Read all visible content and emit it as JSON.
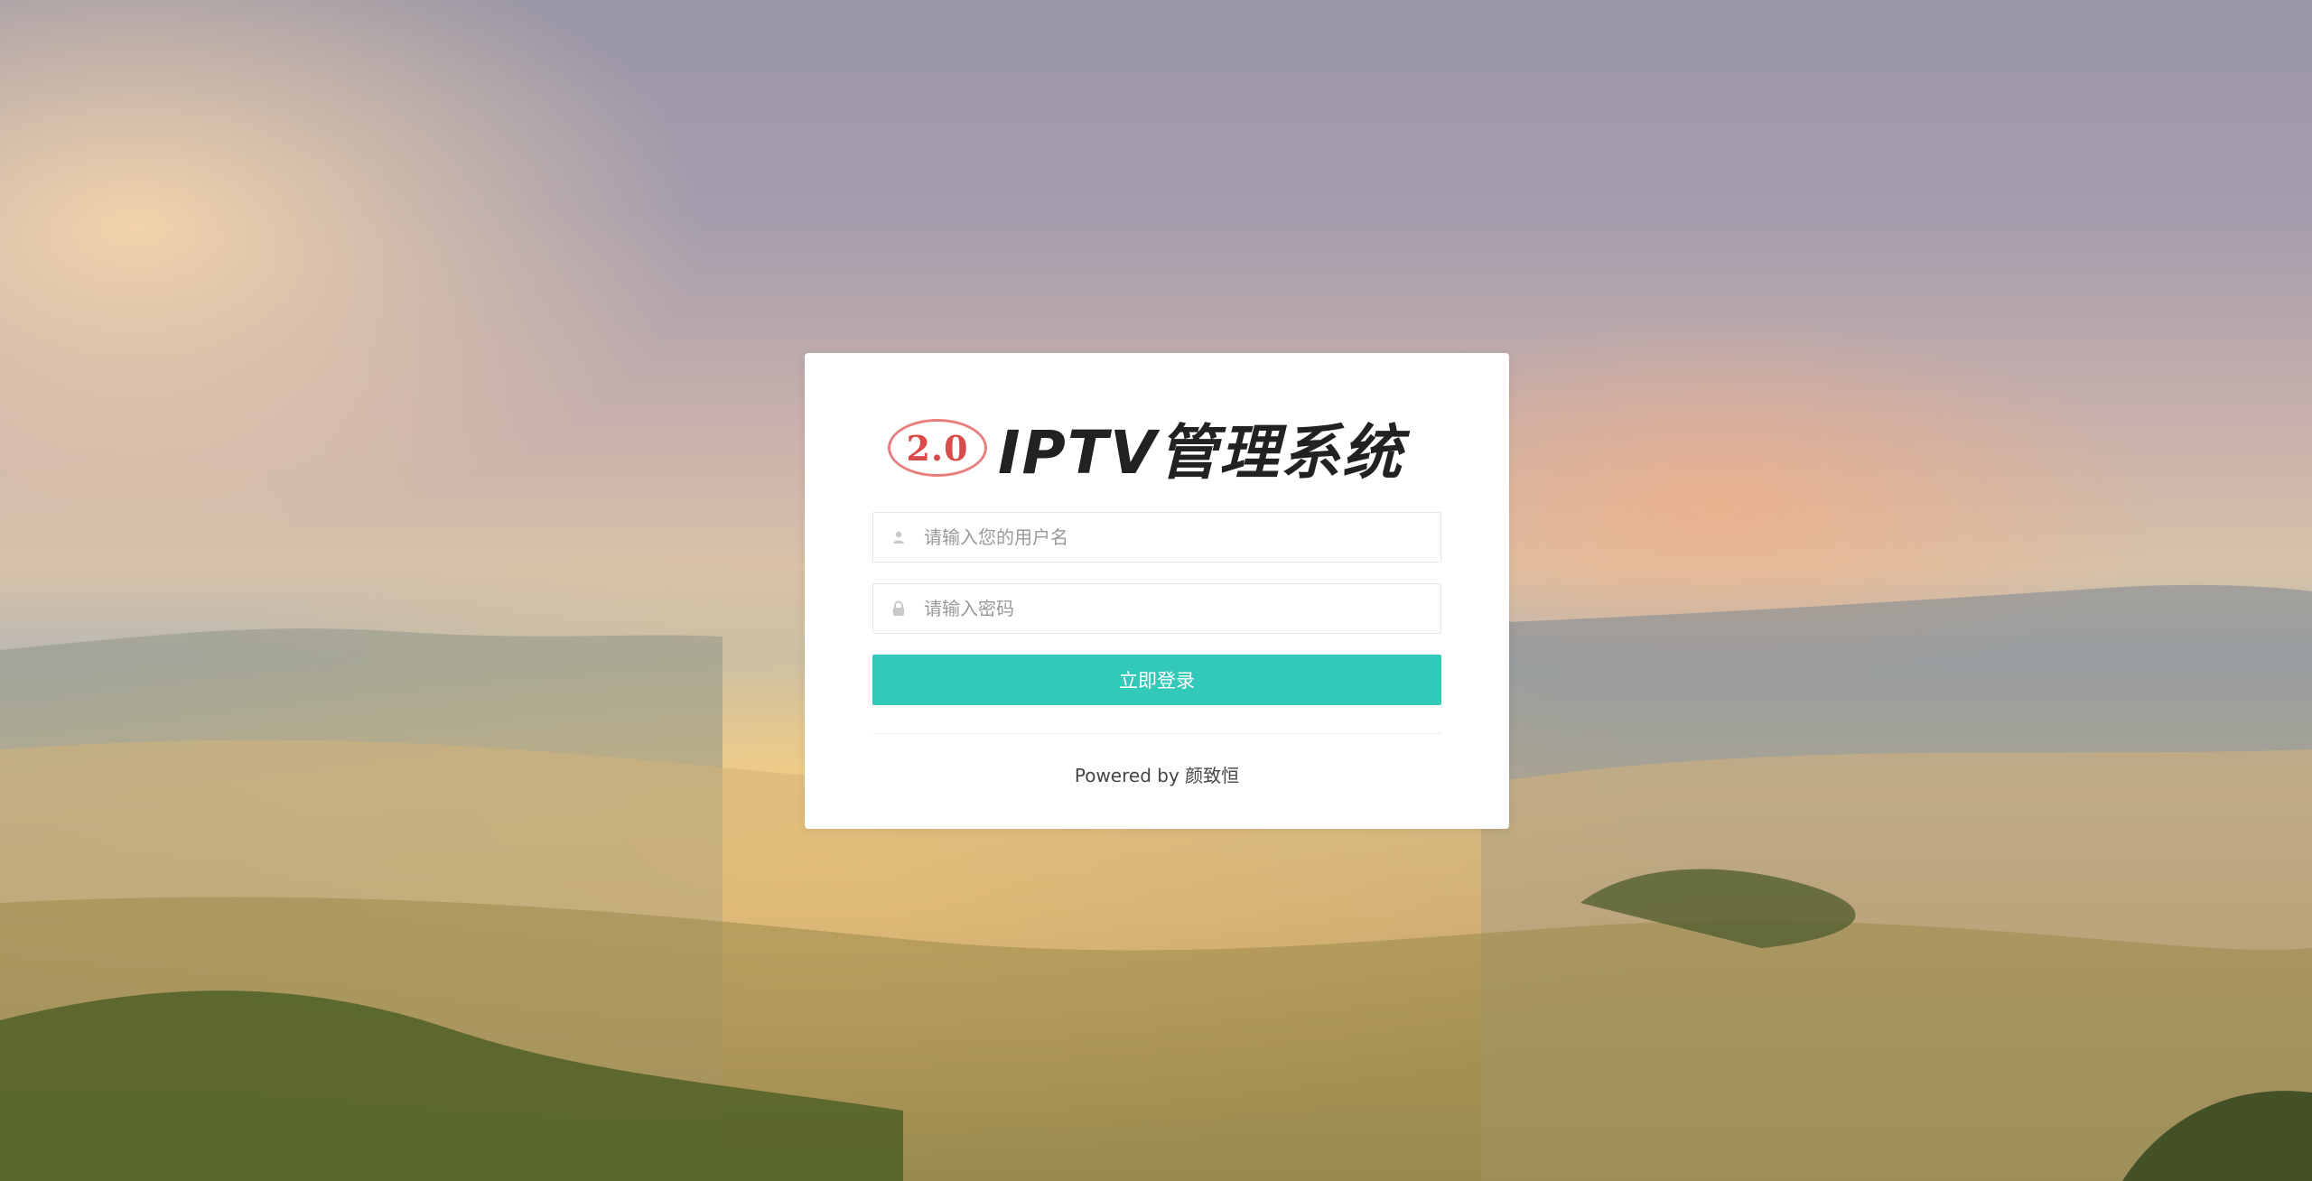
{
  "login": {
    "logo_badge": "2.0",
    "logo_title": "IPTV管理系统",
    "username": {
      "placeholder": "请输入您的用户名",
      "value": "",
      "icon": "user-icon"
    },
    "password": {
      "placeholder": "请输入密码",
      "value": "",
      "icon": "lock-icon"
    },
    "submit_label": "立即登录",
    "footer_text": "Powered by 颜致恒"
  },
  "colors": {
    "accent": "#32c9b8",
    "card_bg": "#ffffff",
    "badge": "#e88080"
  }
}
